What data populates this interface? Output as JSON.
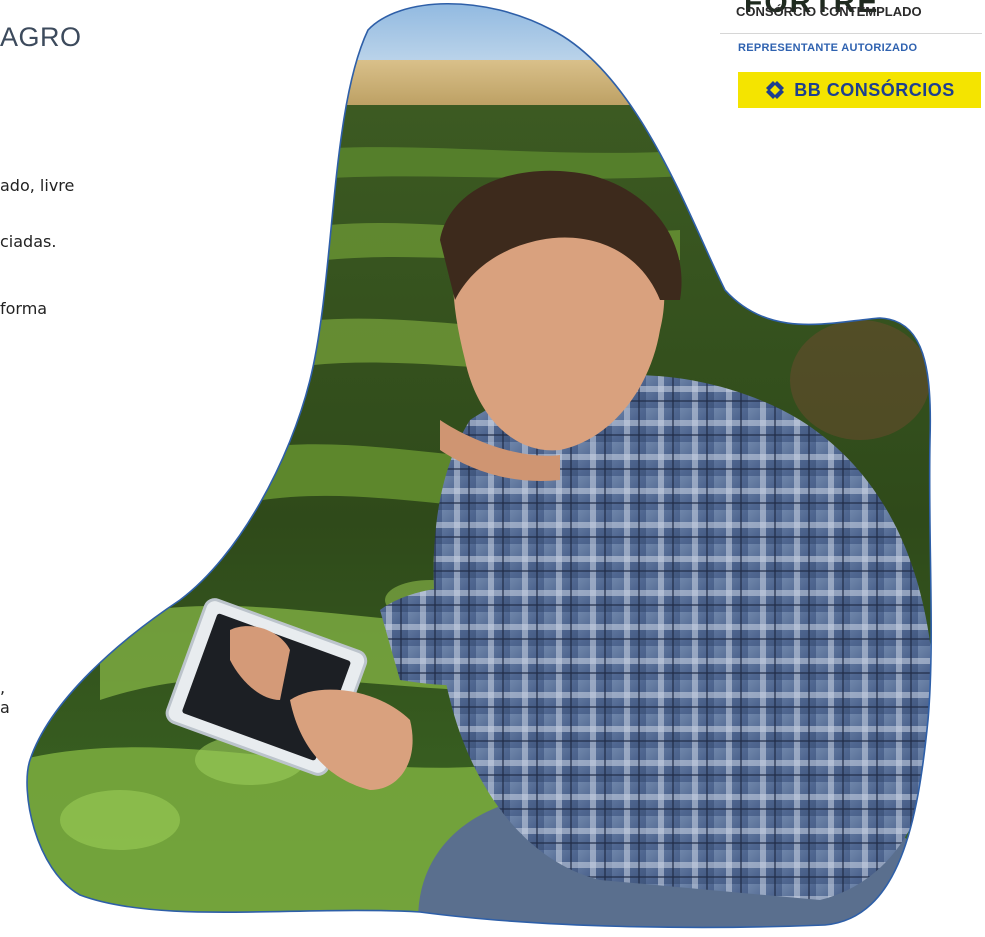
{
  "heading": "AGRO",
  "text_fragments": [
    "ado, livre",
    "ciadas.",
    "forma",
    ",",
    "a"
  ],
  "logo": {
    "top_text": "FORTRE",
    "subtitle": "CONSÓRCIO CONTEMPLADO",
    "representative": "REPRESENTANTE AUTORIZADO",
    "brand": "BB CONSÓRCIOS"
  },
  "colors": {
    "heading": "#3c4a5c",
    "blob_outline": "#2e5fa8",
    "bb_yellow": "#f4e400",
    "bb_blue": "#1d3f8f",
    "rep_blue": "#2f62b0"
  },
  "icons": {
    "brand_mark": "bb-logo-icon"
  }
}
